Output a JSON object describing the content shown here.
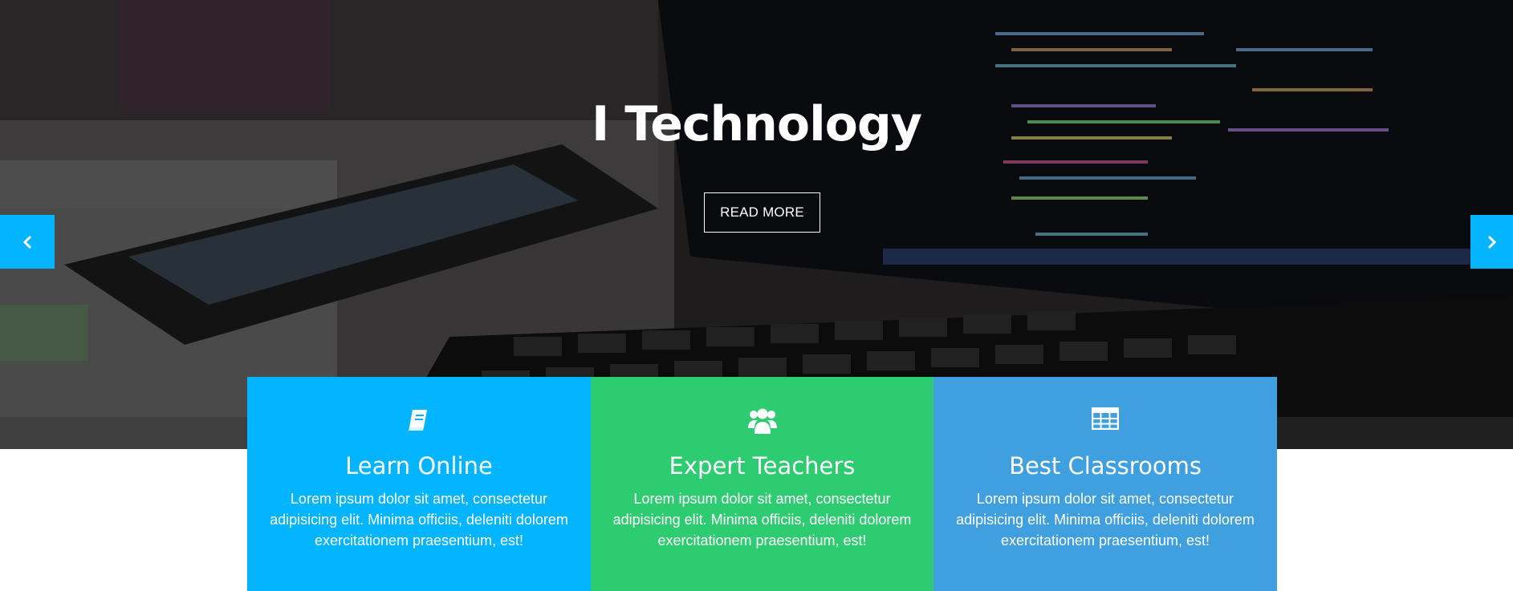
{
  "hero": {
    "title": "I Technology",
    "button_label": "READ MORE",
    "prev_icon": "chevron-left-icon",
    "next_icon": "chevron-right-icon"
  },
  "features": [
    {
      "icon": "book-icon",
      "title": "Learn Online",
      "text": "Lorem ipsum dolor sit amet, consectetur adipisicing elit. Minima officiis, deleniti dolorem exercitationem praesentium, est!",
      "color": "#03b5ff"
    },
    {
      "icon": "users-icon",
      "title": "Expert Teachers",
      "text": "Lorem ipsum dolor sit amet, consectetur adipisicing elit. Minima officiis, deleniti dolorem exercitationem praesentium, est!",
      "color": "#2ecc71"
    },
    {
      "icon": "table-icon",
      "title": "Best Classrooms",
      "text": "Lorem ipsum dolor sit amet, consectetur adipisicing elit. Minima officiis, deleniti dolorem exercitationem praesentium, est!",
      "color": "#3f9fdf"
    }
  ],
  "colors": {
    "accent": "#03b5ff",
    "green": "#2ecc71",
    "blue": "#3f9fdf"
  }
}
